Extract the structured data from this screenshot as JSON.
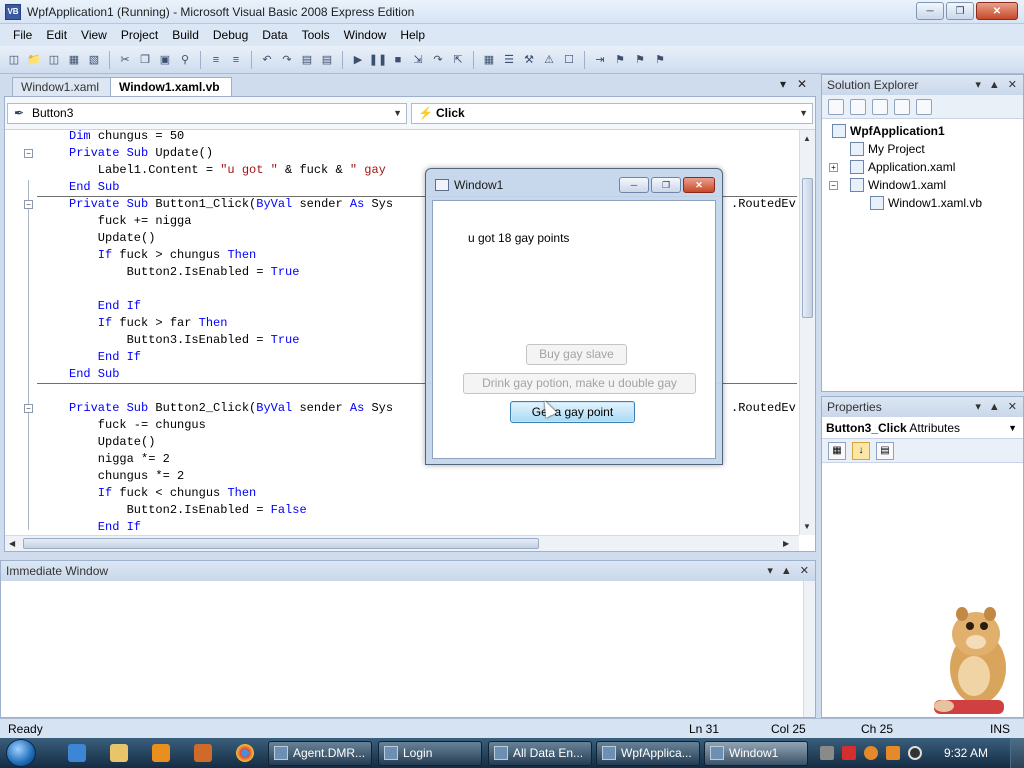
{
  "window": {
    "title": "WpfApplication1 (Running) - Microsoft Visual Basic 2008 Express Edition",
    "app_badge": "VB"
  },
  "menu": [
    "File",
    "Edit",
    "View",
    "Project",
    "Build",
    "Debug",
    "Data",
    "Tools",
    "Window",
    "Help"
  ],
  "doc_tabs": [
    "Window1.xaml",
    "Window1.xaml.vb"
  ],
  "editor": {
    "object_dropdown": "Button3",
    "event_dropdown": "Click",
    "code_lines": [
      [
        {
          "t": "Dim ",
          "c": "kw"
        },
        {
          "t": "chungus = 50"
        }
      ],
      [
        {
          "t": "Private Sub ",
          "c": "kw"
        },
        {
          "t": "Update()"
        }
      ],
      [
        {
          "t": "    Label1.Content = "
        },
        {
          "t": "\"u got \"",
          "c": "st"
        },
        {
          "t": " & fuck & "
        },
        {
          "t": "\" gay",
          "c": "st"
        }
      ],
      [
        {
          "t": "End Sub",
          "c": "kw"
        }
      ],
      [
        {
          "t": "Private Sub ",
          "c": "kw"
        },
        {
          "t": "Button1_Click("
        },
        {
          "t": "ByVal",
          "c": "kw"
        },
        {
          "t": " sender "
        },
        {
          "t": "As",
          "c": "kw"
        },
        {
          "t": " Sys"
        }
      ],
      [
        {
          "t": "    fuck += nigga"
        }
      ],
      [
        {
          "t": "    Update()"
        }
      ],
      [
        {
          "t": "    If",
          "c": "kw"
        },
        {
          "t": " fuck > chungus "
        },
        {
          "t": "Then",
          "c": "kw"
        }
      ],
      [
        {
          "t": "        Button2.IsEnabled = "
        },
        {
          "t": "True",
          "c": "kw"
        }
      ],
      [
        {
          "t": ""
        }
      ],
      [
        {
          "t": "    End If",
          "c": "kw"
        }
      ],
      [
        {
          "t": "    If",
          "c": "kw"
        },
        {
          "t": " fuck > far "
        },
        {
          "t": "Then",
          "c": "kw"
        }
      ],
      [
        {
          "t": "        Button3.IsEnabled = "
        },
        {
          "t": "True",
          "c": "kw"
        }
      ],
      [
        {
          "t": "    End If",
          "c": "kw"
        }
      ],
      [
        {
          "t": "End Sub",
          "c": "kw"
        }
      ],
      [
        {
          "t": ""
        }
      ],
      [
        {
          "t": "Private Sub ",
          "c": "kw"
        },
        {
          "t": "Button2_Click("
        },
        {
          "t": "ByVal",
          "c": "kw"
        },
        {
          "t": " sender "
        },
        {
          "t": "As",
          "c": "kw"
        },
        {
          "t": " Sys"
        }
      ],
      [
        {
          "t": "    fuck -= chungus"
        }
      ],
      [
        {
          "t": "    Update()"
        }
      ],
      [
        {
          "t": "    nigga *= 2"
        }
      ],
      [
        {
          "t": "    chungus *= 2"
        }
      ],
      [
        {
          "t": "    If",
          "c": "kw"
        },
        {
          "t": " fuck < chungus "
        },
        {
          "t": "Then",
          "c": "kw"
        }
      ],
      [
        {
          "t": "        Button2.IsEnabled = "
        },
        {
          "t": "False",
          "c": "kw"
        }
      ],
      [
        {
          "t": "    End If",
          "c": "kw"
        }
      ]
    ],
    "right_fragment": ".RoutedEv"
  },
  "immediate": {
    "title": "Immediate Window"
  },
  "solution_explorer": {
    "title": "Solution Explorer",
    "items": [
      "WpfApplication1",
      "My Project",
      "Application.xaml",
      "Window1.xaml",
      "Window1.xaml.vb"
    ]
  },
  "properties": {
    "title": "Properties",
    "selected_object": "Button3_Click",
    "selected_suffix": "Attributes"
  },
  "wpf_window": {
    "title": "Window1",
    "label": "u got 18 gay points",
    "btn_slave": "Buy gay slave",
    "btn_potion": "Drink gay potion, make u double gay",
    "btn_point": "Get a gay point"
  },
  "status": {
    "ready": "Ready",
    "ln": "Ln 31",
    "col": "Col 25",
    "ch": "Ch 25",
    "ins": "INS"
  },
  "taskbar": {
    "tasks": [
      "Agent.DMR...",
      "Login",
      "All Data En...",
      "WpfApplica...",
      "Window1"
    ],
    "clock": "9:32 AM"
  },
  "colors": {
    "keyword": "#0000ff",
    "string": "#a31515",
    "taskbar": "#1c3750",
    "active_button": "#a7d9f5"
  }
}
